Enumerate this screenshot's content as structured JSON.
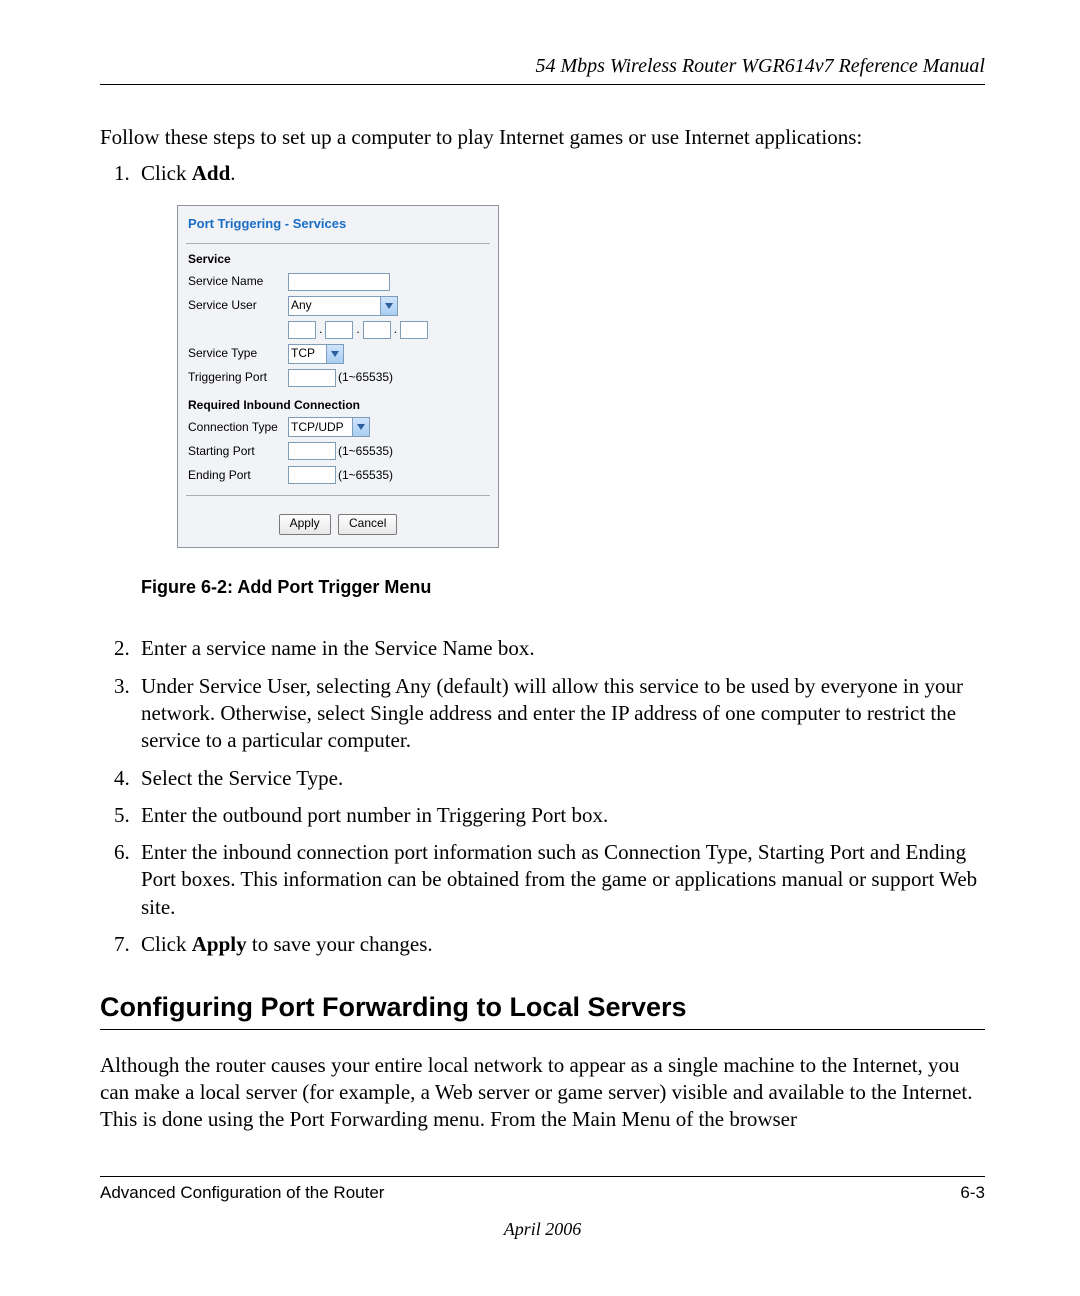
{
  "header": {
    "title": "54 Mbps Wireless Router WGR614v7 Reference Manual"
  },
  "intro": "Follow these steps to set up a computer to play Internet games or use Internet applications:",
  "steps": {
    "s1_pre": "Click ",
    "s1_bold": "Add",
    "s1_post": ".",
    "s2": "Enter a service name in the Service Name box.",
    "s3": "Under Service User, selecting Any (default) will allow this service to be used by everyone in your network. Otherwise, select Single address and enter the IP address of one computer to restrict the service to a particular computer.",
    "s4": "Select the Service Type.",
    "s5": "Enter the outbound port number in Triggering Port box.",
    "s6": "Enter the inbound connection port information such as Connection Type, Starting Port and Ending Port boxes. This information can be obtained from the game or applications manual or support Web site.",
    "s7_pre": "Click ",
    "s7_bold": "Apply",
    "s7_post": " to save your changes."
  },
  "panel": {
    "title": "Port Triggering - Services",
    "section1": "Service",
    "labels": {
      "service_name": "Service Name",
      "service_user": "Service User",
      "service_type": "Service Type",
      "triggering_port": "Triggering Port",
      "connection_type": "Connection Type",
      "starting_port": "Starting Port",
      "ending_port": "Ending Port"
    },
    "values": {
      "service_user": "Any",
      "service_type": "TCP",
      "connection_type": "TCP/UDP"
    },
    "range_hint": "(1~65535)",
    "section2": "Required Inbound Connection",
    "buttons": {
      "apply": "Apply",
      "cancel": "Cancel"
    }
  },
  "figure_caption": "Figure 6-2:  Add Port Trigger Menu",
  "section_heading": "Configuring Port Forwarding to Local Servers",
  "section_para": "Although the router causes your entire local network to appear as a single machine to the Internet, you can make a local server (for example, a Web server or game server) visible and available to the Internet. This is done using the Port Forwarding menu. From the Main Menu of the browser",
  "footer": {
    "left": "Advanced Configuration of the Router",
    "right": "6-3",
    "date": "April 2006"
  }
}
